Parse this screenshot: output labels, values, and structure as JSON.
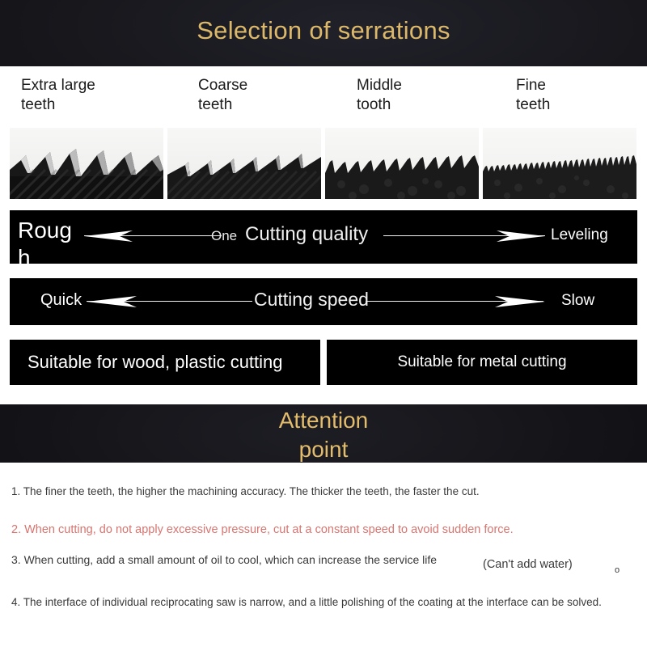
{
  "header": {
    "title": "Selection of serrations",
    "title_color": "#dcb86a",
    "background_color": "#18181d"
  },
  "teeth": {
    "columns": [
      {
        "label_line1": "Extra large",
        "label_line2": "teeth",
        "tooth_count": 5,
        "tooth_style": "extra-large"
      },
      {
        "label_line1": "Coarse",
        "label_line2": "teeth",
        "tooth_count": 7,
        "tooth_style": "coarse"
      },
      {
        "label_line1": "Middle",
        "label_line2": "tooth",
        "tooth_count": 12,
        "tooth_style": "middle"
      },
      {
        "label_line1": "Fine",
        "label_line2": "teeth",
        "tooth_count": 26,
        "tooth_style": "fine"
      }
    ],
    "image_background": "#f3f3f1",
    "tooth_color": "#161616"
  },
  "quality_bar": {
    "left_label": "Rough",
    "center_label": "Cutting quality",
    "overlay_label": "One",
    "right_label": "Leveling",
    "background_color": "#000000",
    "text_color": "#ffffff"
  },
  "speed_bar": {
    "left_label": "Quick",
    "center_label": "Cutting speed",
    "right_label": "Slow",
    "background_color": "#000000",
    "text_color": "#ffffff"
  },
  "suitability": {
    "wood": "Suitable for wood, plastic cutting",
    "metal": "Suitable for metal cutting"
  },
  "attention": {
    "line1": "Attention",
    "line2": "point",
    "title_color": "#e3bd6c"
  },
  "notes": {
    "item1": "1. The finer the teeth, the higher the machining accuracy. The thicker the teeth, the faster the cut.",
    "item2": "2. When cutting, do not apply excessive pressure, cut at a constant speed to avoid sudden force.",
    "item2_color": "#d9746f",
    "item3": "3. When cutting, add a small amount of oil to cool, which can increase the service life",
    "item3_aside": "(Can't add water)",
    "item3_mark": "o",
    "item4": "4. The interface of individual reciprocating saw is narrow, and a little polishing of the coating at the interface can be solved."
  }
}
